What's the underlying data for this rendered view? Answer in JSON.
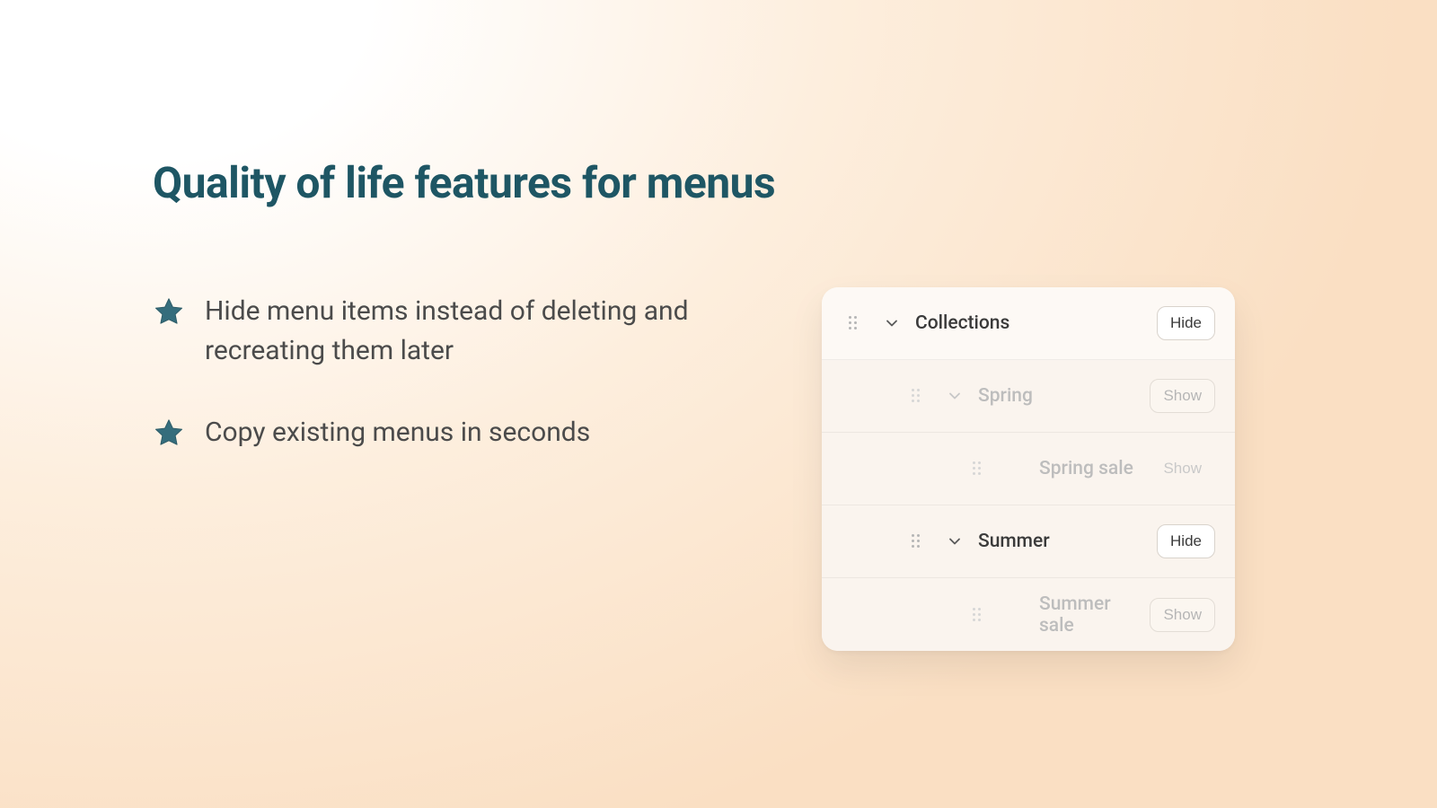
{
  "headline": "Quality of life features for menus",
  "bullets": [
    {
      "text": "Hide menu items instead of deleting and recreating them later"
    },
    {
      "text": "Copy existing menus in seconds"
    }
  ],
  "panel": {
    "rows": [
      {
        "label": "Collections",
        "button": "Hide",
        "level": 0,
        "hasChevron": true,
        "dim": false,
        "btnStyle": "normal"
      },
      {
        "label": "Spring",
        "button": "Show",
        "level": 1,
        "hasChevron": true,
        "dim": true,
        "btnStyle": "dimout"
      },
      {
        "label": "Spring sale",
        "button": "Show",
        "level": 2,
        "hasChevron": false,
        "dim": true,
        "btnStyle": "ghost"
      },
      {
        "label": "Summer",
        "button": "Hide",
        "level": 1,
        "hasChevron": true,
        "dim": false,
        "btnStyle": "normal"
      },
      {
        "label": "Summer sale",
        "button": "Show",
        "level": 2,
        "hasChevron": false,
        "dim": true,
        "btnStyle": "dimout"
      }
    ]
  },
  "colors": {
    "headline": "#1e5664",
    "star": "#356d7c"
  }
}
